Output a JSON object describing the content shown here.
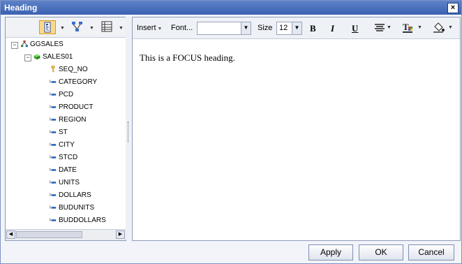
{
  "window": {
    "title": "Heading",
    "close_glyph": "×"
  },
  "left_toolbar": {
    "buttons": [
      {
        "name": "tree-view-icon",
        "selected": true
      },
      {
        "name": "hierarchy-view-icon",
        "selected": false
      },
      {
        "name": "list-view-icon",
        "selected": false
      }
    ]
  },
  "tree": {
    "root": {
      "label": "GGSALES",
      "icon": "hierarchy-icon",
      "expanded": true
    },
    "segment": {
      "label": "SALES01",
      "icon": "segment-cube-icon",
      "expanded": true
    },
    "fields": [
      {
        "label": "SEQ_NO",
        "icon": "key-icon"
      },
      {
        "label": "CATEGORY",
        "icon": "field-icon"
      },
      {
        "label": "PCD",
        "icon": "field-icon"
      },
      {
        "label": "PRODUCT",
        "icon": "field-icon"
      },
      {
        "label": "REGION",
        "icon": "field-icon"
      },
      {
        "label": "ST",
        "icon": "field-icon"
      },
      {
        "label": "CITY",
        "icon": "field-icon"
      },
      {
        "label": "STCD",
        "icon": "field-icon"
      },
      {
        "label": "DATE",
        "icon": "field-icon"
      },
      {
        "label": "UNITS",
        "icon": "field-icon"
      },
      {
        "label": "DOLLARS",
        "icon": "field-icon"
      },
      {
        "label": "BUDUNITS",
        "icon": "field-icon"
      },
      {
        "label": "BUDDOLLARS",
        "icon": "field-icon"
      }
    ]
  },
  "editor_toolbar": {
    "insert_label": "Insert",
    "font_label": "Font...",
    "font_value": "",
    "size_label": "Size",
    "size_value": "12",
    "bold": "B",
    "italic": "I",
    "underline": "U"
  },
  "editor": {
    "content": "This is a FOCUS heading."
  },
  "buttons": {
    "apply": "Apply",
    "ok": "OK",
    "cancel": "Cancel"
  }
}
